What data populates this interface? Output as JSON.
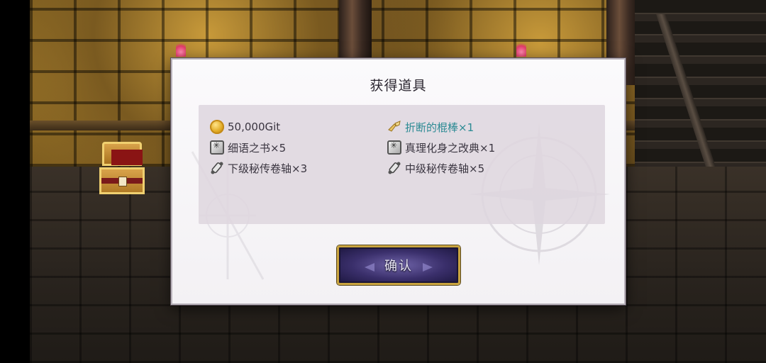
{
  "dialog": {
    "title": "获得道具",
    "confirm_label": "确认"
  },
  "rewards": [
    {
      "icon": "gold-coin-icon",
      "label": "50,000Git",
      "highlight": false
    },
    {
      "icon": "broken-stick-icon",
      "label": "折断的棍棒×1",
      "highlight": true
    },
    {
      "icon": "book-icon",
      "label": "细语之书×5",
      "highlight": false
    },
    {
      "icon": "book-icon",
      "label": "真理化身之改典×1",
      "highlight": false
    },
    {
      "icon": "scroll-icon",
      "label": "下级秘传卷轴×3",
      "highlight": false
    },
    {
      "icon": "scroll-icon",
      "label": "中级秘传卷轴×5",
      "highlight": false
    }
  ],
  "colors": {
    "highlight_text": "#2b8a93",
    "button_border": "#c9a43f",
    "button_fill": "#3a2f6b"
  }
}
